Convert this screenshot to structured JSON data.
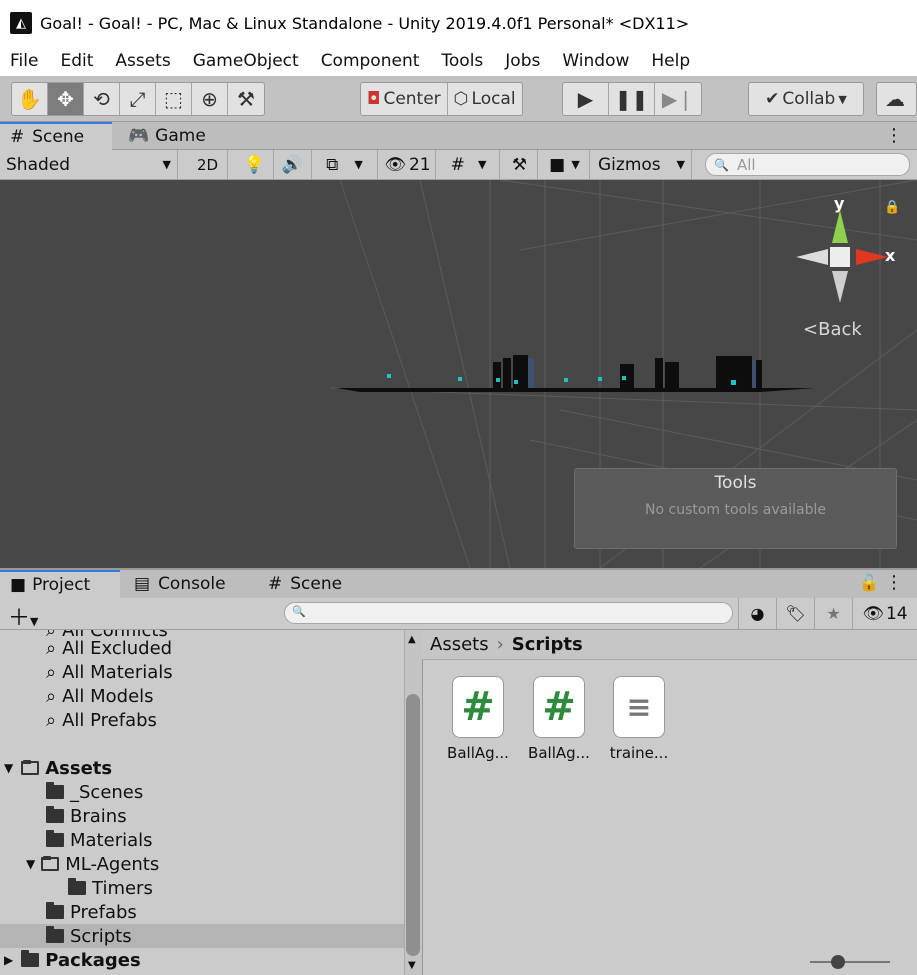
{
  "window": {
    "title": "Goal! - Goal! - PC, Mac & Linux Standalone - Unity 2019.4.0f1 Personal* <DX11>"
  },
  "menu": [
    "File",
    "Edit",
    "Assets",
    "GameObject",
    "Component",
    "Tools",
    "Jobs",
    "Window",
    "Help"
  ],
  "toolbar": {
    "tools": [
      "hand-icon",
      "move-icon",
      "rotate-icon",
      "scale-icon",
      "rect-icon",
      "transform-icon",
      "custom-tool-icon"
    ],
    "center_label": "Center",
    "local_label": "Local",
    "collab_label": "Collab"
  },
  "top_tabs": {
    "scene": "Scene",
    "game": "Game"
  },
  "scene_bar": {
    "shading": "Shaded",
    "mode2d": "2D",
    "hidden_count": "21",
    "gizmos": "Gizmos",
    "search_placeholder": "All"
  },
  "viewport": {
    "axis_y": "y",
    "axis_x": "x",
    "back_label": "Back",
    "tools_title": "Tools",
    "tools_subtitle": "No custom tools available"
  },
  "bottom_tabs": {
    "project": "Project",
    "console": "Console",
    "scene": "Scene"
  },
  "project": {
    "visible_count": "14",
    "tree": [
      {
        "label": "All Conflicts",
        "type": "search",
        "indent": 0
      },
      {
        "label": "All Excluded",
        "type": "search",
        "indent": 0
      },
      {
        "label": "All Materials",
        "type": "search",
        "indent": 0
      },
      {
        "label": "All Models",
        "type": "search",
        "indent": 0
      },
      {
        "label": "All Prefabs",
        "type": "search",
        "indent": 0
      },
      {
        "label": "Assets",
        "type": "root",
        "indent": 0
      },
      {
        "label": "_Scenes",
        "type": "folder",
        "indent": 1
      },
      {
        "label": "Brains",
        "type": "folder",
        "indent": 1
      },
      {
        "label": "Materials",
        "type": "folder",
        "indent": 1
      },
      {
        "label": "ML-Agents",
        "type": "openfolder",
        "indent": 1
      },
      {
        "label": "Timers",
        "type": "folder",
        "indent": 2
      },
      {
        "label": "Prefabs",
        "type": "folder",
        "indent": 1
      },
      {
        "label": "Scripts",
        "type": "folder",
        "indent": 1
      },
      {
        "label": "Packages",
        "type": "root",
        "indent": 0
      }
    ],
    "breadcrumb": {
      "root": "Assets",
      "current": "Scripts"
    },
    "assets": [
      {
        "name": "BallAg...",
        "type": "csharp"
      },
      {
        "name": "BallAg...",
        "type": "csharp"
      },
      {
        "name": "traine...",
        "type": "text"
      }
    ]
  }
}
